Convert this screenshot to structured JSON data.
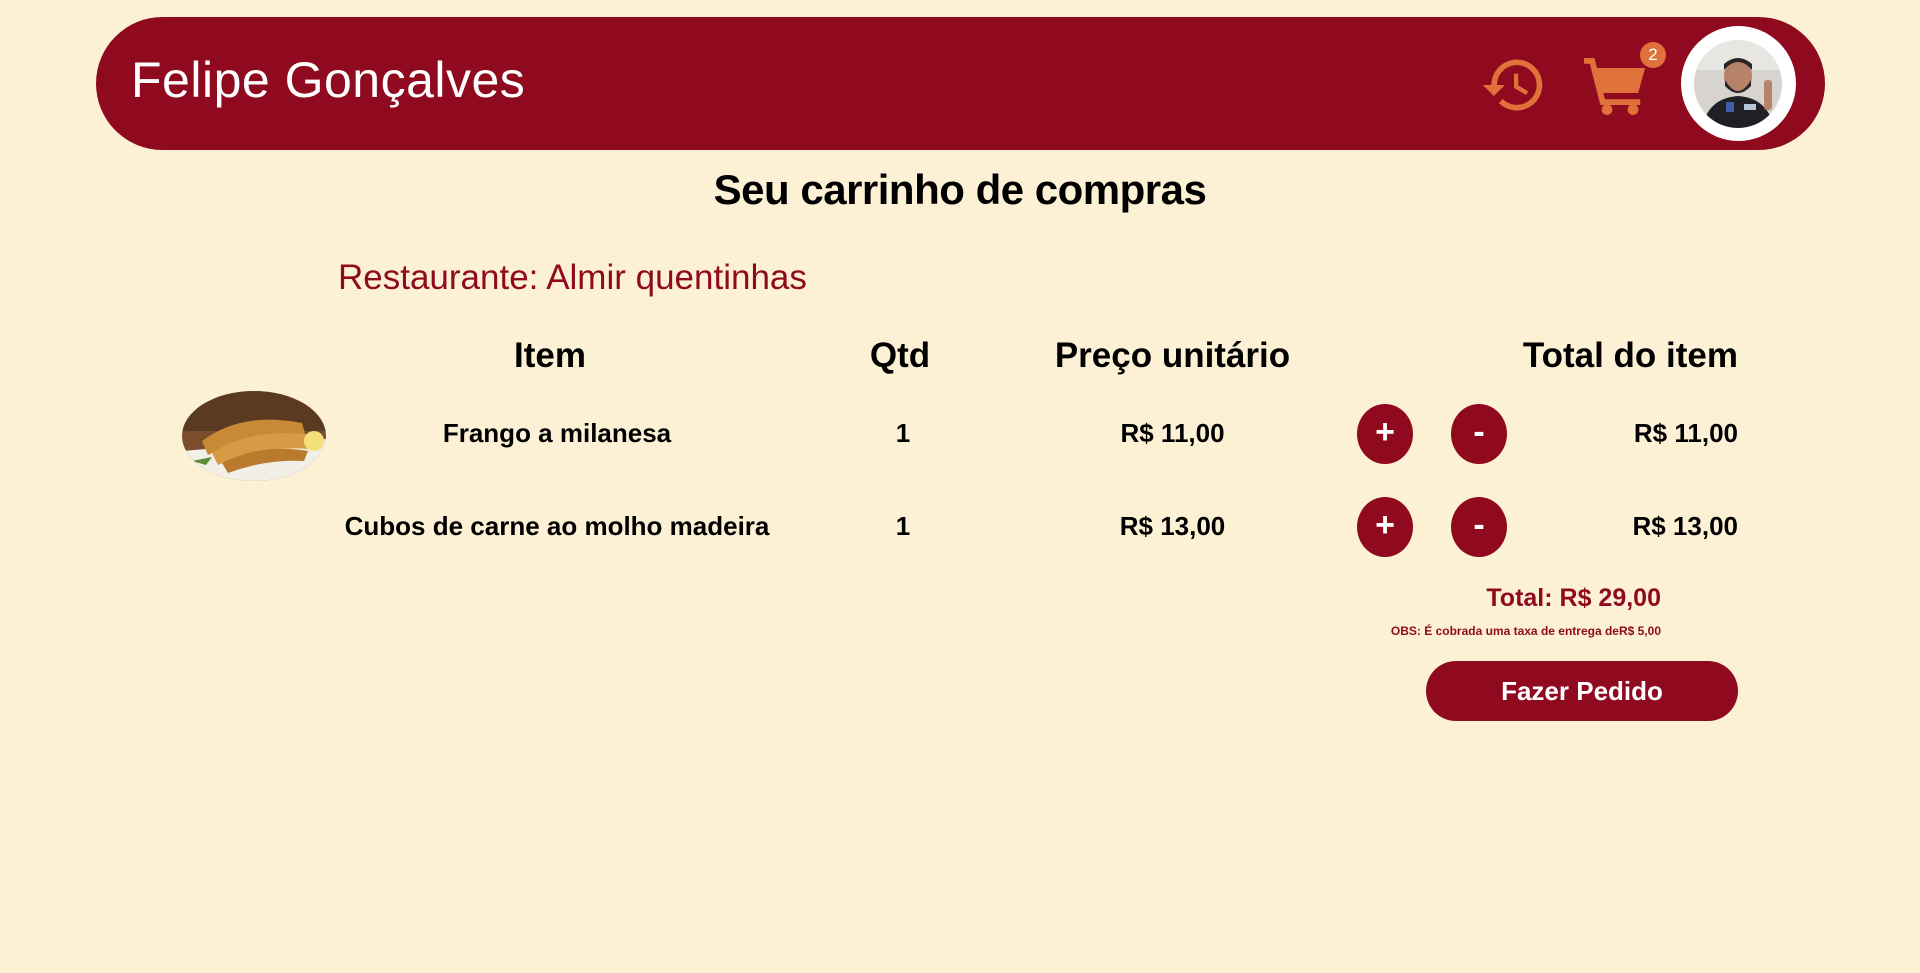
{
  "header": {
    "user_name": "Felipe Gonçalves",
    "history_icon": "history-icon",
    "cart_icon": "cart-icon",
    "cart_count": "2",
    "avatar": "user-avatar"
  },
  "page": {
    "title": "Seu carrinho de compras",
    "restaurant": "Restaurante: Almir quentinhas"
  },
  "table": {
    "headers": [
      "Item",
      "Qtd",
      "Preço unitário",
      "Total do item"
    ],
    "rows": [
      {
        "name": "Frango a milanesa",
        "qty": "1",
        "unit_price": "R$ 11,00",
        "plus": "+",
        "minus": "-",
        "total": "R$ 11,00",
        "image": "food-photo"
      },
      {
        "name": "Cubos de carne ao molho madeira",
        "qty": "1",
        "unit_price": "R$ 13,00",
        "plus": "+",
        "minus": "-",
        "total": "R$ 13,00"
      }
    ]
  },
  "summary": {
    "total": "Total: R$ 29,00",
    "obs": "OBS: É cobrada uma taxa de entrega deR$ 5,00",
    "order_button": "Fazer Pedido"
  },
  "colors": {
    "background": "#fdf1d5",
    "primary": "#8f0a1f",
    "accent": "#e0713a"
  }
}
